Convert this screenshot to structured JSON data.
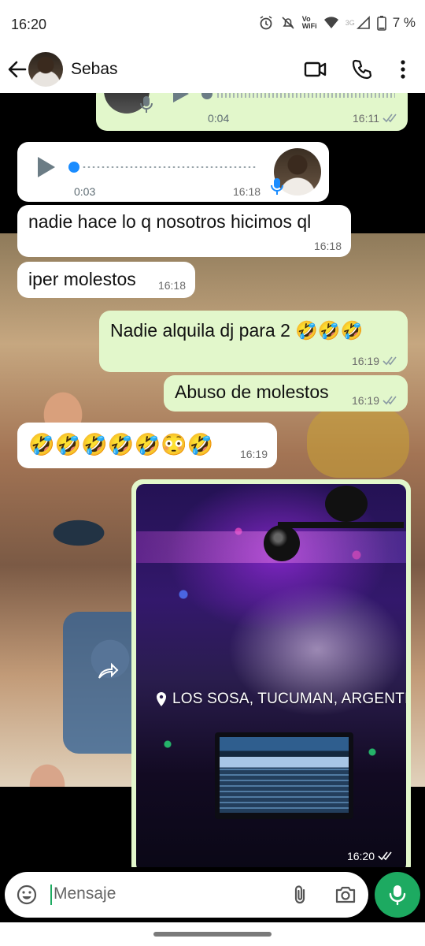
{
  "status_bar": {
    "time": "16:20",
    "wifi_label_top": "Vo",
    "wifi_label_bottom": "WiFi",
    "network": "3G",
    "battery": "7 %"
  },
  "header": {
    "contact_name": "Sebas"
  },
  "messages": [
    {
      "type": "voice",
      "direction": "out",
      "duration": "0:04",
      "time": "16:11",
      "read": true
    },
    {
      "type": "voice",
      "direction": "in",
      "duration": "0:03",
      "time": "16:18"
    },
    {
      "type": "text",
      "direction": "in",
      "text": "nadie hace lo q nosotros hicimos ql",
      "time": "16:18"
    },
    {
      "type": "text",
      "direction": "in",
      "text": "iper molestos",
      "time": "16:18"
    },
    {
      "type": "text",
      "direction": "out",
      "text": "Nadie alquila dj para 2 🤣🤣🤣",
      "time": "16:19",
      "read": true
    },
    {
      "type": "text",
      "direction": "out",
      "text": "Abuso de molestos",
      "time": "16:19",
      "read": true
    },
    {
      "type": "text",
      "direction": "in",
      "text": "🤣🤣🤣🤣🤣😳🤣",
      "time": "16:19"
    },
    {
      "type": "image",
      "direction": "out",
      "location": "LOS SOSA, TUCUMAN, ARGENTINA",
      "time": "16:20",
      "read": true
    }
  ],
  "input": {
    "placeholder": "Mensaje"
  },
  "colors": {
    "outgoing_bubble": "#e2f7cb",
    "incoming_bubble": "#ffffff",
    "accent_green": "#1daa61",
    "read_tick": "#53a6e8"
  }
}
